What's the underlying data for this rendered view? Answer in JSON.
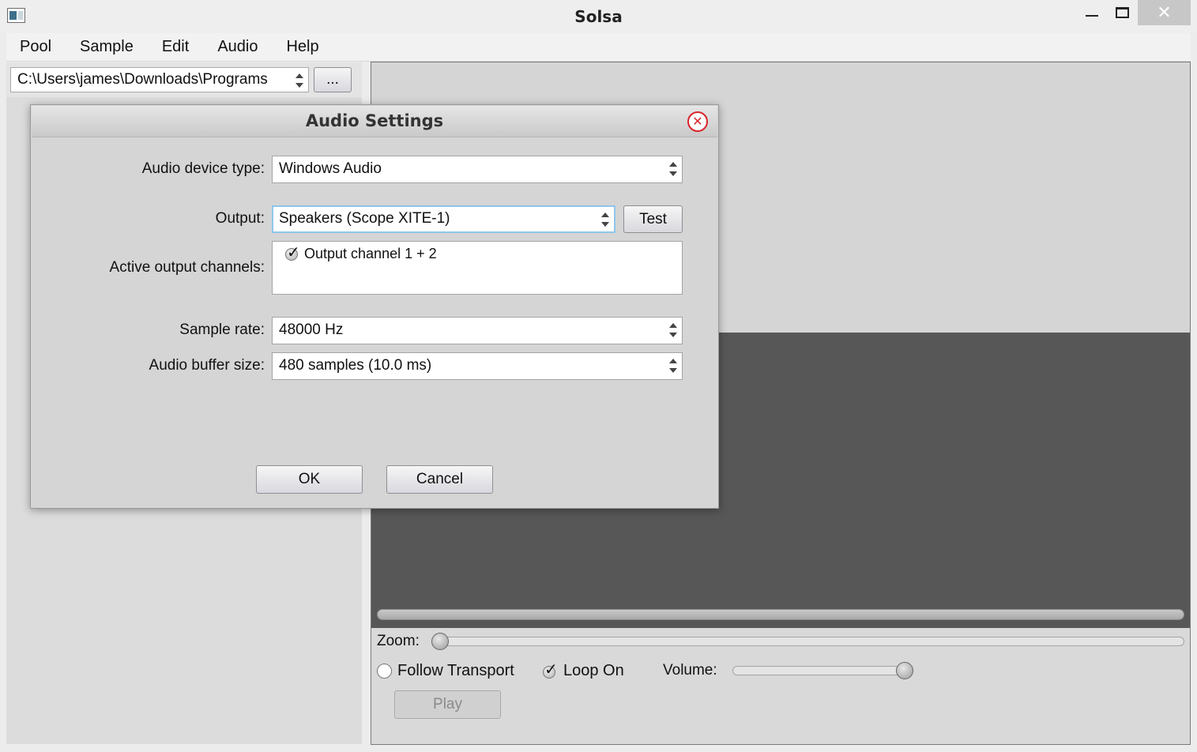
{
  "window": {
    "title": "Solsa",
    "minimize_glyph": "—",
    "maximize_glyph": "☐",
    "close_glyph": "✕"
  },
  "menu": {
    "items": [
      "Pool",
      "Sample",
      "Edit",
      "Audio",
      "Help"
    ]
  },
  "pool": {
    "path": "C:\\Users\\james\\Downloads\\Programs",
    "browse_label": "..."
  },
  "dialog": {
    "title": "Audio Settings",
    "close_glyph": "✕",
    "device_type": {
      "label": "Audio device type:",
      "value": "Windows Audio"
    },
    "output": {
      "label": "Output:",
      "value": "Speakers (Scope XITE-1)",
      "test_label": "Test"
    },
    "channels": {
      "label": "Active output channels:",
      "items": [
        {
          "label": "Output channel 1 + 2",
          "checked": true
        }
      ]
    },
    "sample_rate": {
      "label": "Sample rate:",
      "value": "48000 Hz"
    },
    "buffer_size": {
      "label": "Audio buffer size:",
      "value": "480 samples (10.0 ms)"
    },
    "ok_label": "OK",
    "cancel_label": "Cancel"
  },
  "transport": {
    "zoom_label": "Zoom:",
    "follow_label": "Follow Transport",
    "follow_checked": false,
    "loop_label": "Loop On",
    "loop_checked": true,
    "volume_label": "Volume:",
    "play_label": "Play"
  },
  "colors": {
    "accent_focus": "#8fc6ea",
    "close_red": "#d8242a"
  },
  "icons": {
    "app": "app-icon",
    "dialog_close": "close-circle-icon",
    "check": "checkmark-icon"
  }
}
